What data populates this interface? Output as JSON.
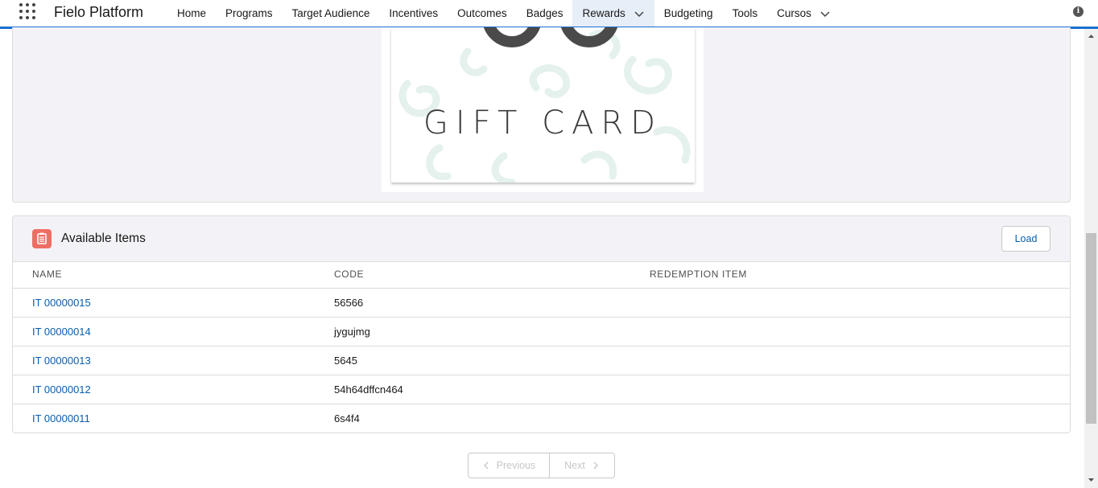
{
  "app": {
    "name": "Fielo Platform"
  },
  "nav": {
    "items": [
      {
        "label": "Home"
      },
      {
        "label": "Programs"
      },
      {
        "label": "Target Audience"
      },
      {
        "label": "Incentives"
      },
      {
        "label": "Outcomes"
      },
      {
        "label": "Badges"
      },
      {
        "label": "Rewards",
        "active": true,
        "has_dropdown": true
      },
      {
        "label": "Budgeting"
      },
      {
        "label": "Tools"
      },
      {
        "label": "Cursos",
        "has_dropdown": true
      }
    ]
  },
  "image_card": {
    "image_text": "GIFT CARD"
  },
  "available_items": {
    "title": "Available Items",
    "load_label": "Load",
    "columns": [
      "NAME",
      "CODE",
      "REDEMPTION ITEM"
    ],
    "rows": [
      {
        "name": "IT 00000015",
        "code": "56566",
        "redemption_item": ""
      },
      {
        "name": "IT 00000014",
        "code": "jygujmg",
        "redemption_item": ""
      },
      {
        "name": "IT 00000013",
        "code": "5645",
        "redemption_item": ""
      },
      {
        "name": "IT 00000012",
        "code": "54h64dffcn464",
        "redemption_item": ""
      },
      {
        "name": "IT 00000011",
        "code": "6s4f4",
        "redemption_item": ""
      }
    ]
  },
  "pager": {
    "previous_label": "Previous",
    "next_label": "Next"
  },
  "icons": {
    "app_launcher": "waffle-icon",
    "info": "info-icon",
    "items": "clipboard-list-icon"
  },
  "colors": {
    "accent": "#1b6fd1",
    "link": "#0b5cab",
    "items_icon": "#ef6e64"
  }
}
